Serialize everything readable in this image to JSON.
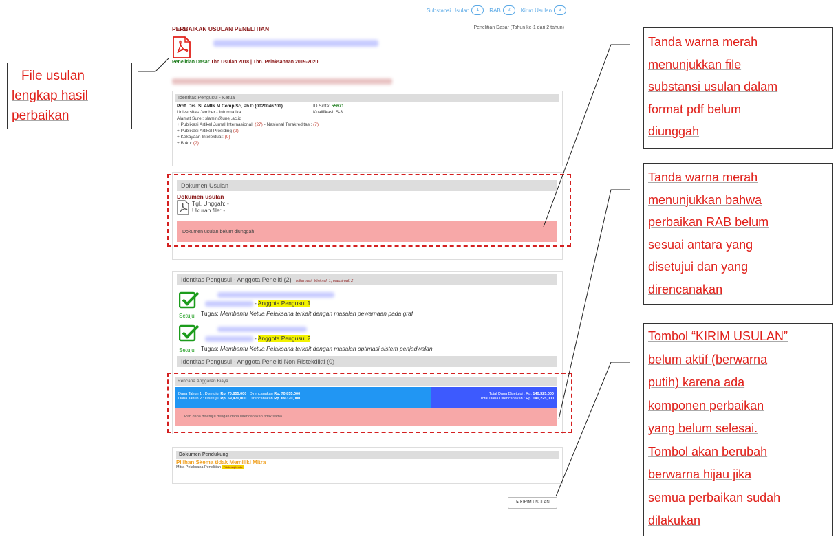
{
  "steps": [
    {
      "label": "Substansi Usulan",
      "num": "1"
    },
    {
      "label": "RAB",
      "num": "2"
    },
    {
      "label": "Kirim Usulan",
      "num": "3"
    }
  ],
  "page": {
    "title": "PERBAIKAN USULAN PENELITIAN",
    "scheme_right": "Penelitian Dasar (Tahun ke-1 dari 2 tahun)",
    "scheme_green": "Penelitian Dasar",
    "scheme_rest": " Thn Usulan 2018 | Thn. Pelaksanaan 2019-2020"
  },
  "ketua": {
    "header": "Identitas Pengusul - Ketua",
    "name": "Prof. Drs. SLAMIN M.Comp.Sc, Ph.D (0020046701)",
    "sinta_label": "ID Sinta: ",
    "sinta_value": "55671",
    "univ": "Universitas Jember - Informatika",
    "kualifikasi": "Kualifikasi: S-3",
    "email": "Alamat Surel: slamin@unej.ac.id",
    "pub_intl_label": "+ Publikasi Artikel Jurnal Internasional: ",
    "pub_intl_value": "(27)",
    "pub_nas_label": " - Nasional Terakreditasi: ",
    "pub_nas_value": "(7)",
    "prosiding_label": "+ Publikasi Artikel Prosiding ",
    "prosiding_value": "(9)",
    "hki_label": "+ Kekayaan Intelektual: ",
    "hki_value": "(0)",
    "buku_label": "+ Buku: ",
    "buku_value": "(2)"
  },
  "dokumen": {
    "header": "Dokumen Usulan",
    "title": "Dokumen usulan",
    "tgl": "Tgl. Unggah: -",
    "ukuran": "Ukuran file: -",
    "alert": "Dokumen usulan belum diunggah"
  },
  "anggota": {
    "header": "Identitas Pengusul - Anggota Peneliti (2)",
    "note": "Informasi: Minimal: 1, maksimal: 2",
    "members": [
      {
        "role": "Anggota Pengusul 1",
        "status": "Setuju",
        "tugas_label": "Tugas: ",
        "tugas": "Membantu Ketua Pelaksana terkait dengan masalah pewarnaan pada graf"
      },
      {
        "role": "Anggota Pengusul 2",
        "status": "Setuju",
        "tugas_label": "Tugas: ",
        "tugas": "Membantu Ketua Pelaksana terkait dengan masalah optimasi sistem penjadwalan"
      }
    ],
    "non_ristek_header": "Identitas Pengusul - Anggota Peneliti Non Ristekdikti (0)"
  },
  "rab": {
    "header": "Rencana Anggaran Biaya",
    "row1_label": "Dana Tahun 1 : Disetujui ",
    "row1_approved": "Rp. 70,855,000",
    "row1_plan_label": " | Direncanakan ",
    "row1_plan": "Rp. 70,855,000",
    "row2_label": "Dana Tahun 2 : Disetujui ",
    "row2_approved": "Rp. 69,470,000",
    "row2_plan_label": " | Direncanakan ",
    "row2_plan": "Rp. 69,370,000",
    "total_approved_label": "Total Dana Disetujui : Rp. ",
    "total_approved": "140,325,000",
    "total_plan_label": "Total Dana Direncanakan : Rp. ",
    "total_plan": "140,225,000",
    "alert": "Rab dana disetujui dengan dana direncanakan tidak sama."
  },
  "pendukung": {
    "header": "Dokumen Pendukung",
    "scheme": "Pilihan Skema tidak Memiliki Mitra",
    "mitra_label": "Mitra Pelaksana Penelitian ",
    "mitra_badge": "Tidak wajib ada"
  },
  "submit": {
    "label": "KIRIM USULAN"
  },
  "callouts": {
    "left": [
      "File usulan",
      "lengkap hasil",
      "perbaikan"
    ],
    "c1": [
      "Tanda warna merah",
      "menunjukkan file",
      "substansi usulan dalam",
      "format pdf belum",
      "diunggah"
    ],
    "c2": [
      "Tanda warna merah",
      "menunjukkan bahwa",
      "perbaikan RAB belum",
      "sesuai antara yang",
      "disetujui dan yang",
      "direncanakan"
    ],
    "c3": [
      "Tombol “KIRIM USULAN”",
      "belum aktif (berwarna",
      "putih) karena ada",
      "komponen perbaikan",
      "yang belum selesai.",
      "Tombol akan berubah",
      "berwarna hijau jika",
      "semua perbaikan sudah",
      "dilakukan"
    ]
  },
  "colors": {
    "accent_red": "#e0201a",
    "title_red": "#8b1a1a",
    "alert_pink": "#f7a8a8",
    "rab_blue": "#2196f3",
    "rab_dark_blue": "#3d5afe",
    "check_green": "#1c9c1c"
  }
}
